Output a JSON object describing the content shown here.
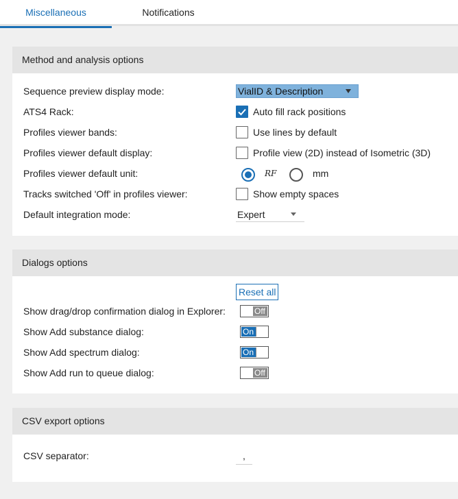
{
  "tabs": [
    {
      "label": "Miscellaneous",
      "active": true
    },
    {
      "label": "Notifications",
      "active": false
    }
  ],
  "method_section": {
    "title": "Method and analysis options",
    "rows": {
      "sequence_preview": {
        "label": "Sequence preview display mode:",
        "value": "VialID & Description"
      },
      "ats4_rack": {
        "label": "ATS4 Rack:",
        "option": "Auto fill rack positions",
        "checked": true
      },
      "profiles_bands": {
        "label": "Profiles viewer bands:",
        "option": "Use lines by default",
        "checked": false
      },
      "profiles_display": {
        "label": "Profiles viewer default display:",
        "option": "Profile view (2D) instead of Isometric (3D)",
        "checked": false
      },
      "profiles_unit": {
        "label": "Profiles viewer default unit:",
        "option_rf": "RF",
        "option_mm": "mm",
        "selected": "RF"
      },
      "tracks_off": {
        "label": "Tracks switched 'Off' in profiles viewer:",
        "option": "Show empty spaces",
        "checked": false
      },
      "integration_mode": {
        "label": "Default integration mode:",
        "value": "Expert"
      }
    }
  },
  "dialogs_section": {
    "title": "Dialogs options",
    "reset_label": "Reset all",
    "rows": [
      {
        "label": "Show drag/drop confirmation dialog in Explorer:",
        "state": "Off"
      },
      {
        "label": "Show Add substance dialog:",
        "state": "On"
      },
      {
        "label": "Show Add spectrum dialog:",
        "state": "On"
      },
      {
        "label": "Show Add run to queue dialog:",
        "state": "Off"
      }
    ]
  },
  "csv_section": {
    "title": "CSV export options",
    "separator_label": "CSV separator:",
    "separator_value": ","
  },
  "colors": {
    "accent": "#1a6fb5",
    "dropdown_bg": "#7fb2dc",
    "section_header": "#e4e4e4"
  }
}
